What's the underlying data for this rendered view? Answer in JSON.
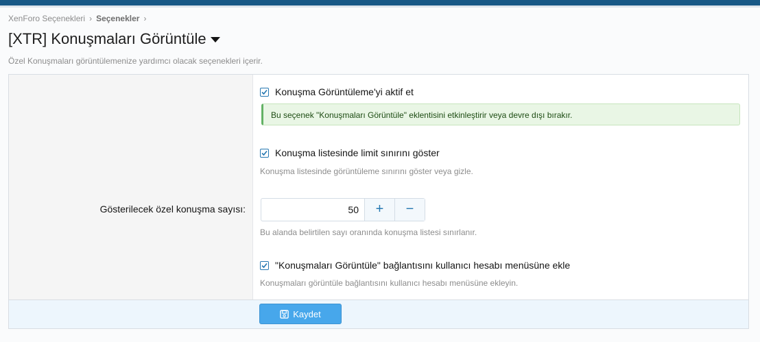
{
  "breadcrumb": {
    "items": [
      "XenForo Seçenekleri",
      "Seçenekler"
    ],
    "separator": "›"
  },
  "page": {
    "title": "[XTR] Konuşmaları Görüntüle",
    "description": "Özel Konuşmaları görüntülemenize yardımcı olacak seçenekleri içerir."
  },
  "options": {
    "enable": {
      "label": "Konuşma Görüntüleme'yi aktif et",
      "checked": true,
      "notice": "Bu seçenek \"Konuşmaları Görüntüle\" eklentisini etkinleştirir veya devre dışı bırakır."
    },
    "show_limit": {
      "label": "Konuşma listesinde limit sınırını göster",
      "checked": true,
      "hint": "Konuşma listesinde görüntüleme sınırını göster veya gizle."
    },
    "count": {
      "row_label": "Gösterilecek özel konuşma sayısı:",
      "value": "50",
      "plus": "+",
      "minus": "−",
      "hint": "Bu alanda belirtilen sayı oranında konuşma listesi sınırlanır."
    },
    "account_menu": {
      "label": "\"Konuşmaları Görüntüle\" bağlantısını kullanıcı hesabı menüsüne ekle",
      "checked": true,
      "hint": "Konuşmaları görüntüle bağlantısını kullanıcı hesabı menüsüne ekleyin."
    }
  },
  "footer": {
    "save_label": "Kaydet",
    "save_icon": "save-icon"
  },
  "colors": {
    "topbar": "#185886",
    "accent": "#2577b1",
    "button": "#47a7eb",
    "notice_bg": "#e9f6e5",
    "notice_border": "#63b265"
  }
}
